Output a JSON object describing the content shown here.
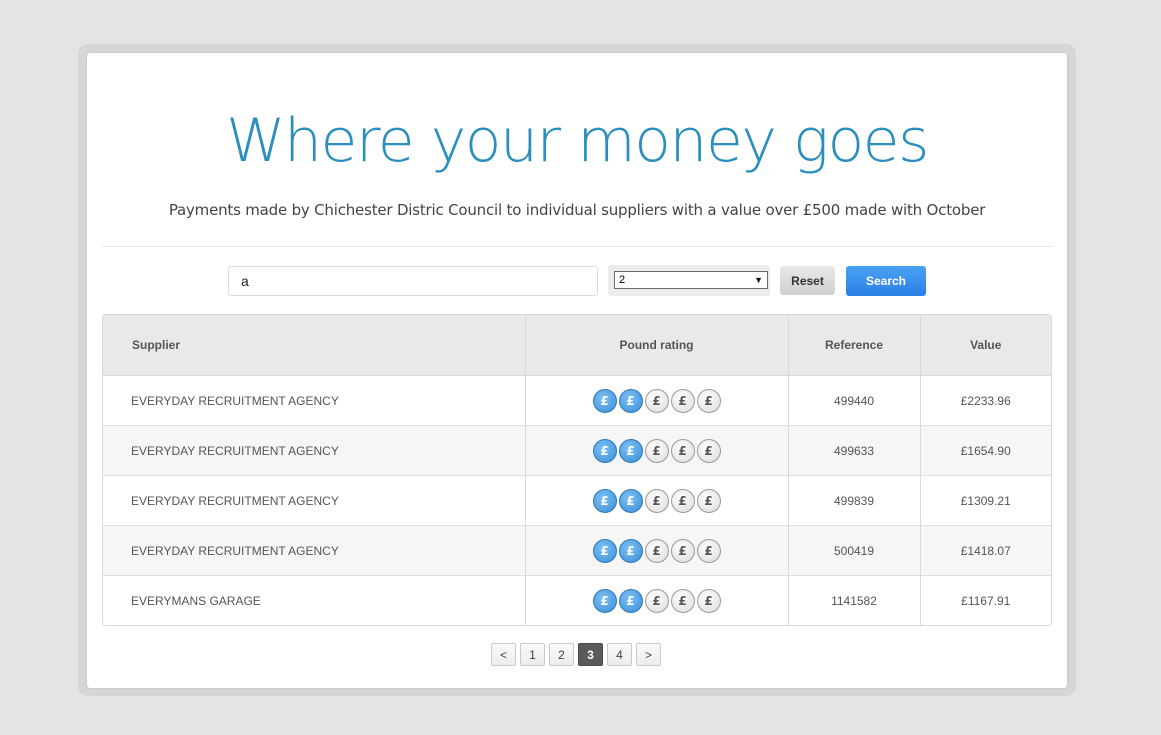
{
  "header": {
    "title": "Where your money goes",
    "subtitle": "Payments made by Chichester Distric Council to individual suppliers with a value over £500 made with October"
  },
  "search": {
    "query": "a",
    "select_value": "2",
    "reset_label": "Reset",
    "search_label": "Search"
  },
  "table": {
    "columns": [
      "Supplier",
      "Pound rating",
      "Reference",
      "Value"
    ],
    "rows": [
      {
        "supplier": "EVERYDAY RECRUITMENT AGENCY",
        "rating": 2,
        "reference": "499440",
        "value": "£2233.96"
      },
      {
        "supplier": "EVERYDAY RECRUITMENT AGENCY",
        "rating": 2,
        "reference": "499633",
        "value": "£1654.90"
      },
      {
        "supplier": "EVERYDAY RECRUITMENT AGENCY",
        "rating": 2,
        "reference": "499839",
        "value": "£1309.21"
      },
      {
        "supplier": "EVERYDAY RECRUITMENT AGENCY",
        "rating": 2,
        "reference": "500419",
        "value": "£1418.07"
      },
      {
        "supplier": "EVERYMANS GARAGE",
        "rating": 2,
        "reference": "1141582",
        "value": "£1167.91"
      }
    ],
    "rating_max": 5,
    "coin_symbol": "£"
  },
  "pagination": {
    "prev": "<",
    "pages": [
      "1",
      "2",
      "3",
      "4"
    ],
    "current": "3",
    "next": ">"
  },
  "colors": {
    "title": "#2a8fbf",
    "search_button": "#2b7fe6",
    "coin_active": "#3a8ed6",
    "page_active": "#5a5a5a"
  }
}
